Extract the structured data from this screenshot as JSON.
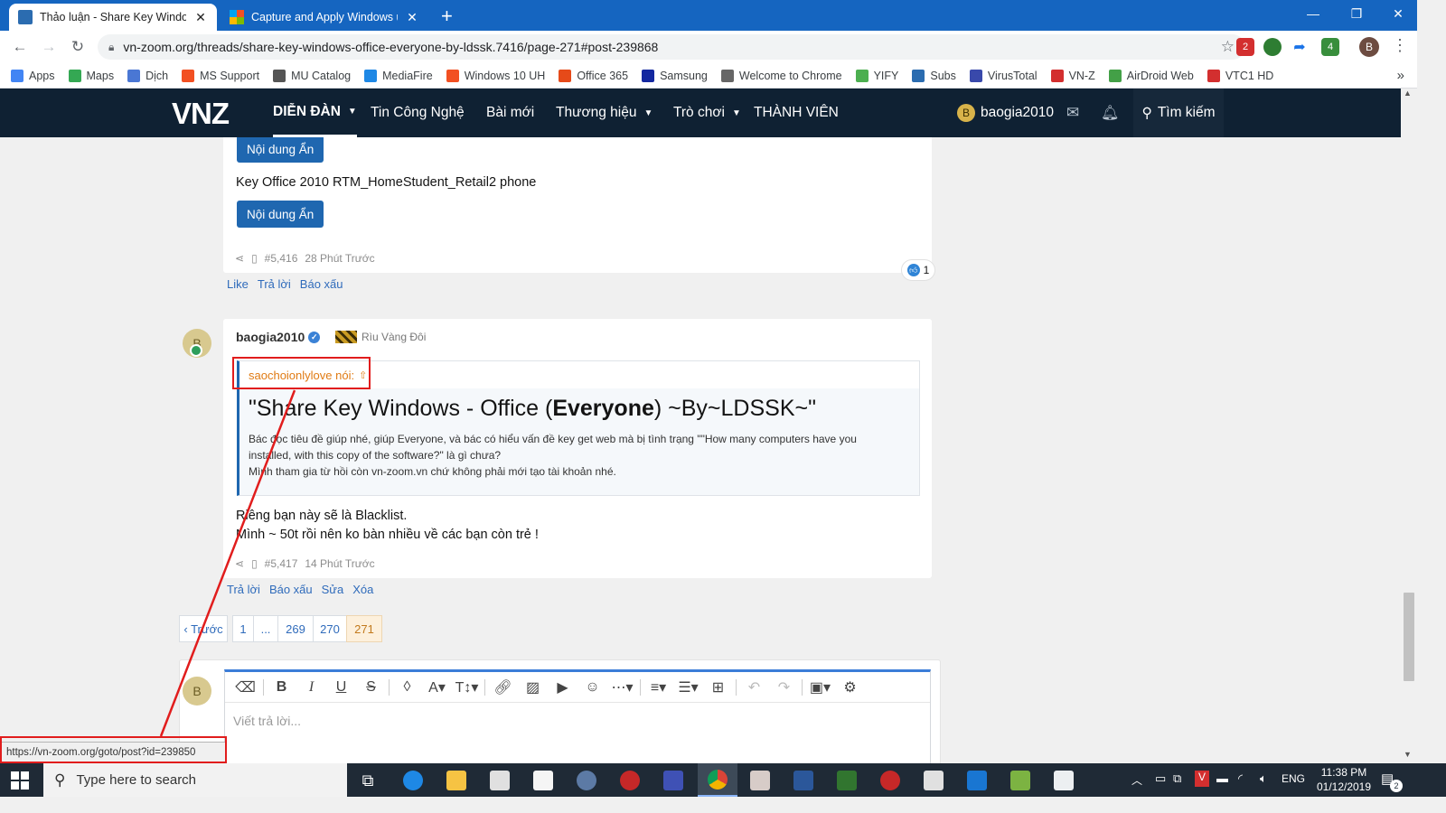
{
  "browser": {
    "tabs": [
      {
        "title": "Thảo luận - Share Key Windows -",
        "active": true
      },
      {
        "title": "Capture and Apply Windows usi",
        "active": false
      }
    ],
    "new_tab": "+",
    "url": "vn-zoom.org/threads/share-key-windows-office-everyone-by-ldssk.7416/page-271#post-239868",
    "profile_initial": "B",
    "ext_badges": [
      "2",
      "4"
    ],
    "bookmarks": [
      "Apps",
      "Maps",
      "Dịch",
      "MS Support",
      "MU Catalog",
      "MediaFire",
      "Windows 10 UH",
      "Office 365",
      "Samsung",
      "Welcome to Chrome",
      "YIFY",
      "Subs",
      "VirusTotal",
      "VN-Z",
      "AirDroid Web",
      "VTC1 HD"
    ],
    "bookmark_colors": [
      "#4285f4",
      "#34a853",
      "#4a77d4",
      "#f25022",
      "#555",
      "#1e88e5",
      "#f25022",
      "#e64a19",
      "#1428a0",
      "#666",
      "#4caf50",
      "#2b6cb0",
      "#3949ab",
      "#d32f2f",
      "#43a047",
      "#d32f2f"
    ],
    "bookmarks_more": "»"
  },
  "site": {
    "logo": "VNZ",
    "nav": [
      "DIỄN ĐÀN",
      "Tin Công Nghệ",
      "Bài mới",
      "Thương hiệu",
      "Trò chơi",
      "THÀNH VIÊN"
    ],
    "user": "baogia2010",
    "user_initial": "B",
    "search": "Tìm kiếm"
  },
  "post1": {
    "hidden_btn_1": "Nội dung Ẩn",
    "text": "Key Office 2010 RTM_HomeStudent_Retail2 phone",
    "hidden_btn_2": "Nội dung Ẩn",
    "number": "#5,416",
    "time": "28 Phút Trước",
    "reaction_count": "1",
    "actions": [
      "Like",
      "Trả lời",
      "Báo xấu"
    ]
  },
  "post2": {
    "avatar_initial": "B",
    "author": "baogia2010",
    "rank": "Rìu Vàng Đôi",
    "quote_author": "saochoionlylove nói:",
    "quote_title_pre": "\"Share Key Windows - Office (",
    "quote_title_bold": "Everyone",
    "quote_title_post": ") ~By~LDSSK~\"",
    "quote_line1": "Bác đọc tiêu đề giúp nhé, giúp Everyone, và bác có hiểu vấn đề key get web mà bị tình trạng \"\"How many computers have you",
    "quote_line2": "installed, with this copy of the software?\" là gì chưa?",
    "quote_line3": "Mình tham gia từ hồi còn vn-zoom.vn chứ không phải mới tạo tài khoản nhé.",
    "body_line1": "Riêng bạn này sẽ là Blacklist.",
    "body_line2": "Mình ~ 50t rồi nên ko bàn nhiều về các bạn còn trẻ !",
    "number": "#5,417",
    "time": "14 Phút Trước",
    "actions": [
      "Trả lời",
      "Báo xấu",
      "Sửa",
      "Xóa"
    ]
  },
  "pagination": {
    "prev": "‹ Trước",
    "pages": [
      "1",
      "...",
      "269",
      "270",
      "271"
    ],
    "current": "271"
  },
  "editor": {
    "avatar_initial": "B",
    "placeholder": "Viết trả lời..."
  },
  "status_url": "https://vn-zoom.org/goto/post?id=239850",
  "taskbar": {
    "search_placeholder": "Type here to search",
    "lang": "ENG",
    "time": "11:38 PM",
    "date": "01/12/2019",
    "notification_count": "2"
  },
  "colors": {
    "chrome_blue": "#1565c0",
    "site_header": "#0f2133",
    "link_blue": "#2f6bbb",
    "highlight_red": "#e11d1d",
    "quote_orange": "#e07b14"
  }
}
